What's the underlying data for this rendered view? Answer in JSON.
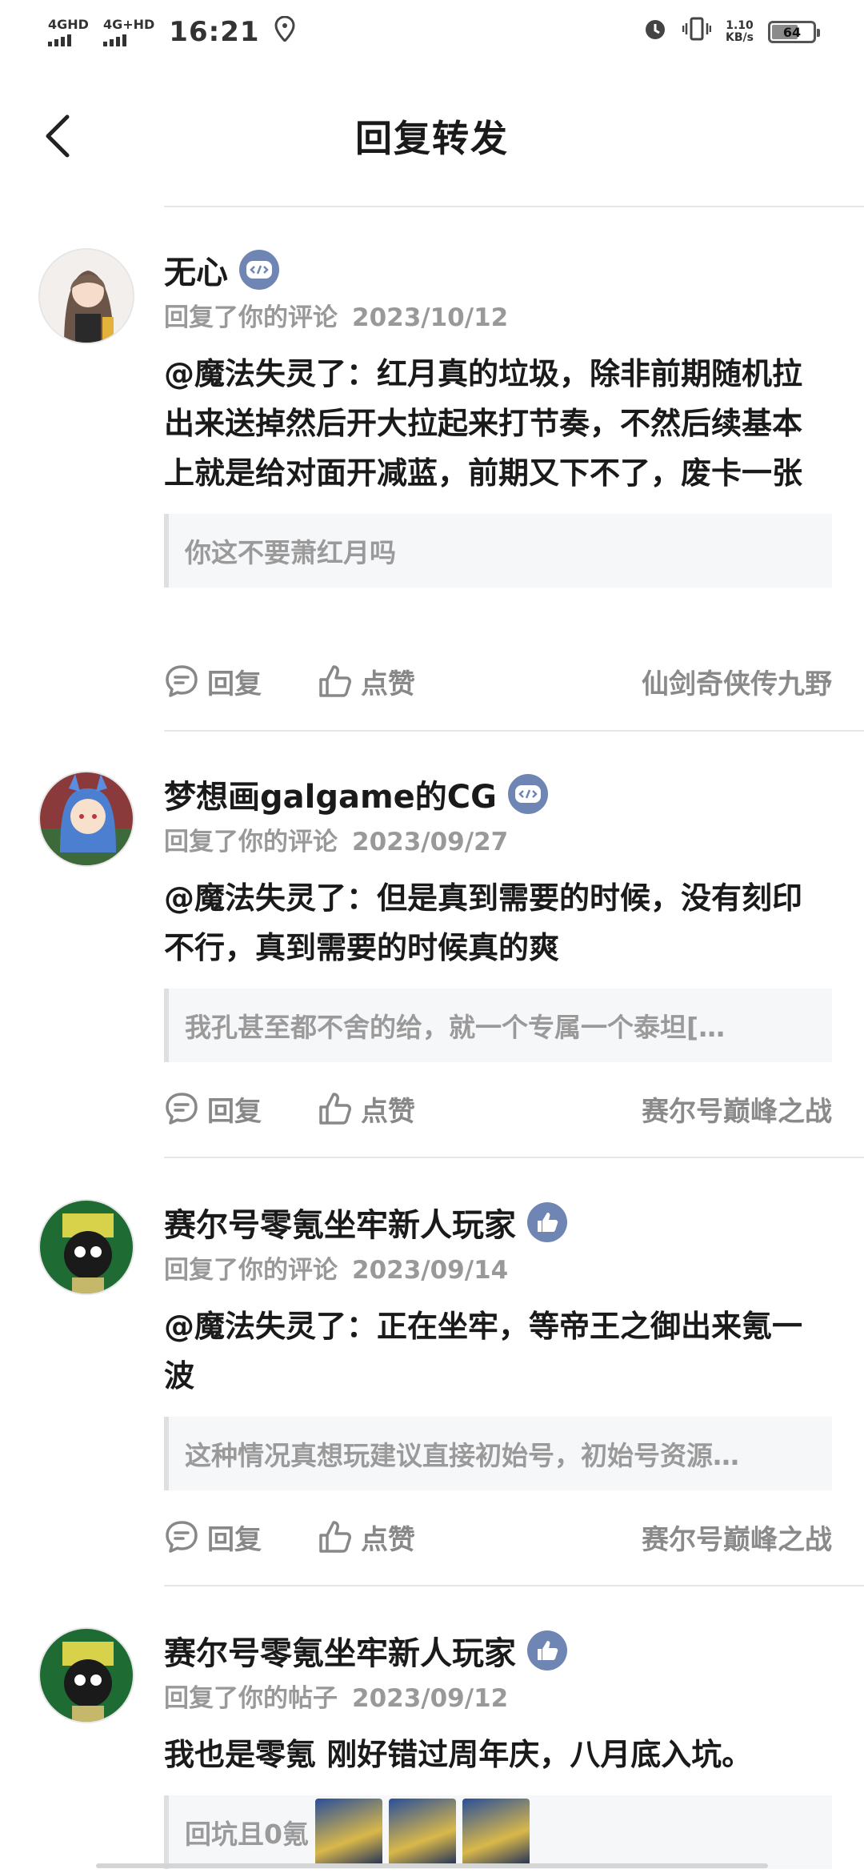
{
  "status_bar": {
    "net1": "4GHD",
    "net2": "4G+HD",
    "time": "16:21",
    "speed_value": "1.10",
    "speed_unit": "KB/s",
    "battery": "64"
  },
  "header": {
    "title": "回复转发"
  },
  "items": [
    {
      "name": "无心",
      "badge_icon": "developer-badge-icon",
      "action": "回复了你的评论",
      "date": "2023/10/12",
      "text": "@魔法失灵了：红月真的垃圾，除非前期随机拉出来送掉然后开大拉起来打节奏，不然后续基本上就是给对面开减蓝，前期又下不了，废卡一张",
      "quote": "你这不要萧红月吗",
      "reply_label": "回复",
      "like_label": "点赞",
      "source": "仙剑奇侠传九野"
    },
    {
      "name": "梦想画galgame的CG",
      "badge_icon": "developer-badge-icon",
      "action": "回复了你的评论",
      "date": "2023/09/27",
      "text": "@魔法失灵了：但是真到需要的时候，没有刻印不行，真到需要的时候真的爽",
      "quote": "我孔甚至都不舍的给，就一个专属一个泰坦[…",
      "reply_label": "回复",
      "like_label": "点赞",
      "source": "赛尔号巅峰之战"
    },
    {
      "name": "赛尔号零氪坐牢新人玩家",
      "badge_icon": "thumbs-up-badge-icon",
      "action": "回复了你的评论",
      "date": "2023/09/14",
      "text": "@魔法失灵了：正在坐牢，等帝王之御出来氪一波",
      "quote": "这种情况真想玩建议直接初始号，初始号资源…",
      "reply_label": "回复",
      "like_label": "点赞",
      "source": "赛尔号巅峰之战"
    },
    {
      "name": "赛尔号零氪坐牢新人玩家",
      "badge_icon": "thumbs-up-badge-icon",
      "action": "回复了你的帖子",
      "date": "2023/09/12",
      "text": "我也是零氪 刚好错过周年庆，八月底入坑。",
      "quote": "回坑且0氪"
    }
  ],
  "colors": {
    "badge": "#6f86b5",
    "meta": "#999999",
    "divider": "#e6e6e6"
  }
}
